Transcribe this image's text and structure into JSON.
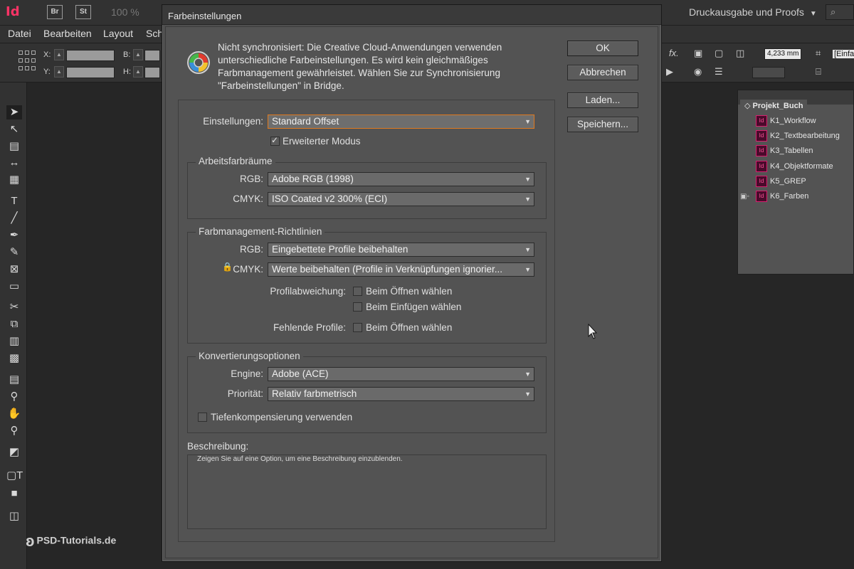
{
  "app": {
    "logo": "Id",
    "bridge_buttons": [
      "Br",
      "St"
    ],
    "zoom": "100 %",
    "workspace": "Druckausgabe und Proofs",
    "search_placeholder": "",
    "menu": [
      "Datei",
      "Bearbeiten",
      "Layout",
      "Schr"
    ],
    "control": {
      "x_label": "X:",
      "y_label": "Y:",
      "w_label": "B:",
      "h_label": "H:",
      "stroke_value": "4,233 mm",
      "frame_label": "[Einfa"
    }
  },
  "book_panel": {
    "title": "Projekt_Buch",
    "chapters": [
      "K1_Workflow",
      "K2_Textbearbeitung",
      "K3_Tabellen",
      "K4_Objektformate",
      "K5_GREP",
      "K6_Farben"
    ],
    "doc_badge": "Id"
  },
  "dialog": {
    "title": "Farbeinstellungen",
    "sync_message": "Nicht synchronisiert: Die Creative Cloud-Anwendungen verwenden unterschiedliche Farbeinstellungen. Es wird kein gleichmäßiges Farbmanagement gewährleistet. Wählen Sie zur Synchronisierung \"Farbeinstellungen\" in Bridge.",
    "buttons": {
      "ok": "OK",
      "cancel": "Abbrechen",
      "load": "Laden...",
      "save": "Speichern..."
    },
    "settings_label": "Einstellungen:",
    "settings_value": "Standard Offset",
    "advanced_mode": "Erweiterter Modus",
    "working_spaces": {
      "legend": "Arbeitsfarbräume",
      "rgb_label": "RGB:",
      "rgb_value": "Adobe RGB (1998)",
      "cmyk_label": "CMYK:",
      "cmyk_value": "ISO Coated v2 300% (ECI)"
    },
    "policies": {
      "legend": "Farbmanagement-Richtlinien",
      "rgb_label": "RGB:",
      "rgb_value": "Eingebettete Profile beibehalten",
      "cmyk_label": "CMYK:",
      "cmyk_value": "Werte beibehalten (Profile in Verknüpfungen ignorier...",
      "mismatch_label": "Profilabweichung:",
      "mismatch_open": "Beim Öffnen wählen",
      "mismatch_paste": "Beim Einfügen wählen",
      "missing_label": "Fehlende Profile:",
      "missing_open": "Beim Öffnen wählen"
    },
    "conversion": {
      "legend": "Konvertierungsoptionen",
      "engine_label": "Engine:",
      "engine_value": "Adobe (ACE)",
      "intent_label": "Priorität:",
      "intent_value": "Relativ farbmetrisch",
      "bpc": "Tiefenkompensierung verwenden"
    },
    "description_label": "Beschreibung:",
    "description_text": "Zeigen Sie auf eine Option, um eine Beschreibung einzublenden."
  },
  "watermark": "PSD-Tutorials.de"
}
